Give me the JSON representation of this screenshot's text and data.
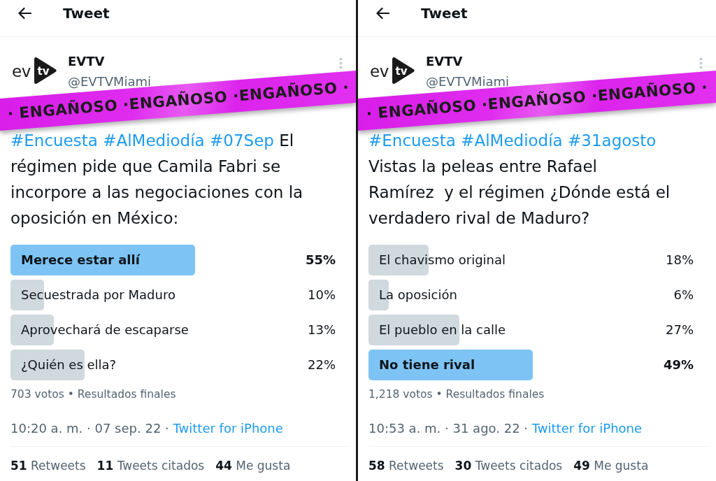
{
  "tweets": [
    {
      "header": {
        "title": "Tweet"
      },
      "author": {
        "logo": {
          "text": "ev",
          "badge_text": "tv"
        },
        "name": "EVTV",
        "handle": "@EVTVMiami"
      },
      "banner": {
        "text": "· ENGAÑOSO ·ENGAÑOSO ·ENGAÑOSO ·"
      },
      "text": [
        {
          "kind": "hashtag",
          "text": "#Encuesta"
        },
        {
          "kind": "hashtag",
          "text": "#AlMediodía"
        },
        {
          "kind": "hashtag",
          "text": "#07Sep"
        },
        {
          "kind": "plain",
          "text": "El régimen pide que Camila Fabri se incorpore a las negociaciones con la oposición en México:"
        }
      ],
      "poll": {
        "options": [
          {
            "label": "Merece estar allí",
            "percent": "55%",
            "level": 0.55,
            "winner": true
          },
          {
            "label": "Secuestrada por Maduro",
            "percent": "10%",
            "level": 0.1,
            "winner": false
          },
          {
            "label": "Aprovechará de escaparse",
            "percent": "13%",
            "level": 0.13,
            "winner": false
          },
          {
            "label": "¿Quién es ella?",
            "percent": "22%",
            "level": 0.22,
            "winner": false
          }
        ],
        "summary": "703 votos • Resultados finales"
      },
      "timestamp": "10:20 a. m. · 07 sep. 22 ·",
      "source": "Twitter for iPhone",
      "stats": [
        {
          "count": "51",
          "label": "Retweets"
        },
        {
          "count": "11",
          "label": "Tweets citados"
        },
        {
          "count": "44",
          "label": "Me gusta"
        }
      ]
    },
    {
      "header": {
        "title": "Tweet"
      },
      "author": {
        "logo": {
          "text": "ev",
          "badge_text": "tv"
        },
        "name": "EVTV",
        "handle": "@EVTVMiami"
      },
      "banner": {
        "text": "· ENGAÑOSO ·ENGAÑOSO ·ENGAÑOSO ·"
      },
      "text": [
        {
          "kind": "hashtag",
          "text": "#Encuesta"
        },
        {
          "kind": "hashtag",
          "text": "#AlMediodía"
        },
        {
          "kind": "hashtag",
          "text": "#31agosto"
        },
        {
          "kind": "plain",
          "text": "Vistas la peleas entre Rafael\nRamírez  y el régimen ¿Dónde está el verdadero rival de Maduro?"
        }
      ],
      "poll": {
        "options": [
          {
            "label": "El chavismo original",
            "percent": "18%",
            "level": 0.18,
            "winner": false
          },
          {
            "label": "La oposición",
            "percent": "6%",
            "level": 0.06,
            "winner": false
          },
          {
            "label": "El pueblo en la calle",
            "percent": "27%",
            "level": 0.27,
            "winner": false
          },
          {
            "label": "No tiene rival",
            "percent": "49%",
            "level": 0.49,
            "winner": true
          }
        ],
        "summary": "1,218 votos • Resultados finales"
      },
      "timestamp": "10:53 a. m. · 31 ago. 22 ·",
      "source": "Twitter for iPhone",
      "stats": [
        {
          "count": "58",
          "label": "Retweets"
        },
        {
          "count": "30",
          "label": "Tweets citados"
        },
        {
          "count": "49",
          "label": "Me gusta"
        }
      ]
    }
  ]
}
